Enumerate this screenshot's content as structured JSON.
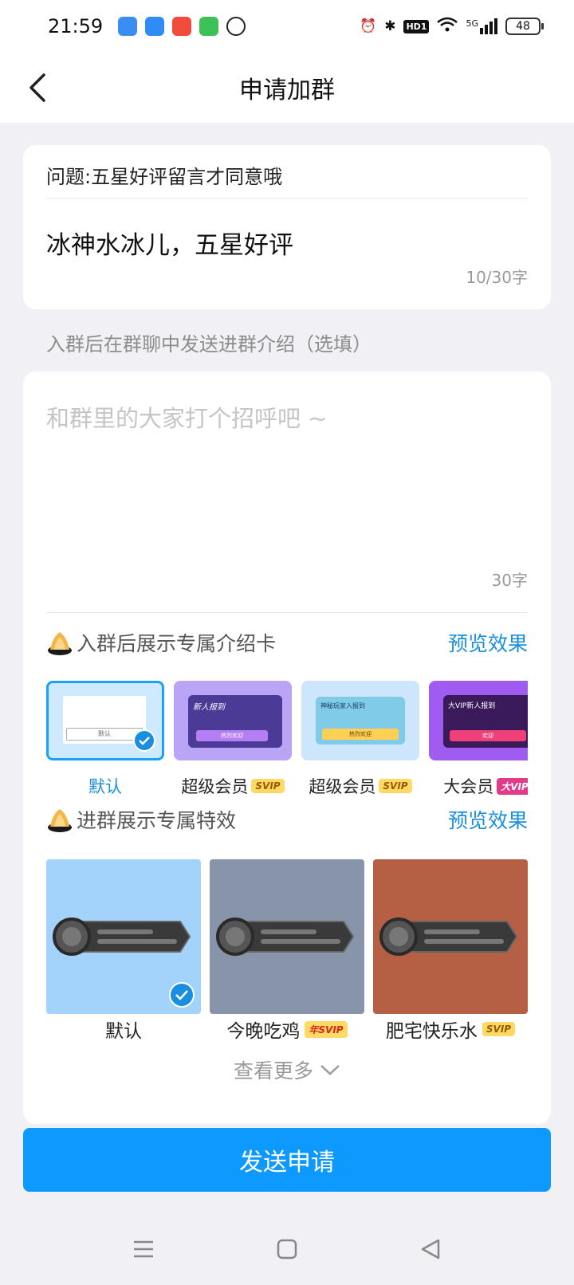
{
  "status": {
    "time": "21:59",
    "network": "5G",
    "hd": "HD1",
    "battery": "48",
    "app_colors": [
      "#3b8cf5",
      "#2f8cf7",
      "#f04b3c",
      "#3cc058",
      "#222222"
    ]
  },
  "nav": {
    "title": "申请加群"
  },
  "question": {
    "label": "问题:五星好评留言才同意哦",
    "answer": "冰神水冰儿，五星好评",
    "count": "10/30字"
  },
  "intro_hint": "入群后在群聊中发送进群介绍（选填）",
  "intro": {
    "placeholder": "和群里的大家打个招呼吧 ~",
    "count": "30字"
  },
  "intro_card_section": {
    "title": "入群后展示专属介绍卡",
    "preview": "预览效果",
    "cards": [
      {
        "label": "默认",
        "badge": "",
        "selected": true
      },
      {
        "label": "超级会员",
        "badge": "SVIP",
        "selected": false
      },
      {
        "label": "超级会员",
        "badge": "SVIP",
        "selected": false
      },
      {
        "label": "大会员",
        "badge": "大VIP",
        "selected": false
      }
    ],
    "card_texts": {
      "default_mini": "默认",
      "card2_title": "新人报到",
      "card2_btn": "热烈欢迎",
      "card3_title": "神秘玩家入报到",
      "card3_btn": "热烈欢迎",
      "card4_title": "大VIP新人报到",
      "card4_btn": "欢迎"
    }
  },
  "effect_section": {
    "title": "进群展示专属特效",
    "preview": "预览效果",
    "effects": [
      {
        "label": "默认",
        "badge": "",
        "color": "#a3d3fb",
        "selected": true
      },
      {
        "label": "今晚吃鸡",
        "badge": "年SVIP",
        "color": "#8794aa",
        "selected": false
      },
      {
        "label": "肥宅快乐水",
        "badge": "SVIP",
        "color": "#b55f45",
        "selected": false
      }
    ],
    "more": "查看更多"
  },
  "send_button": "发送申请",
  "colors": {
    "accent": "#0d99ff",
    "link": "#1a8fe0",
    "background": "#f0f0f5"
  }
}
